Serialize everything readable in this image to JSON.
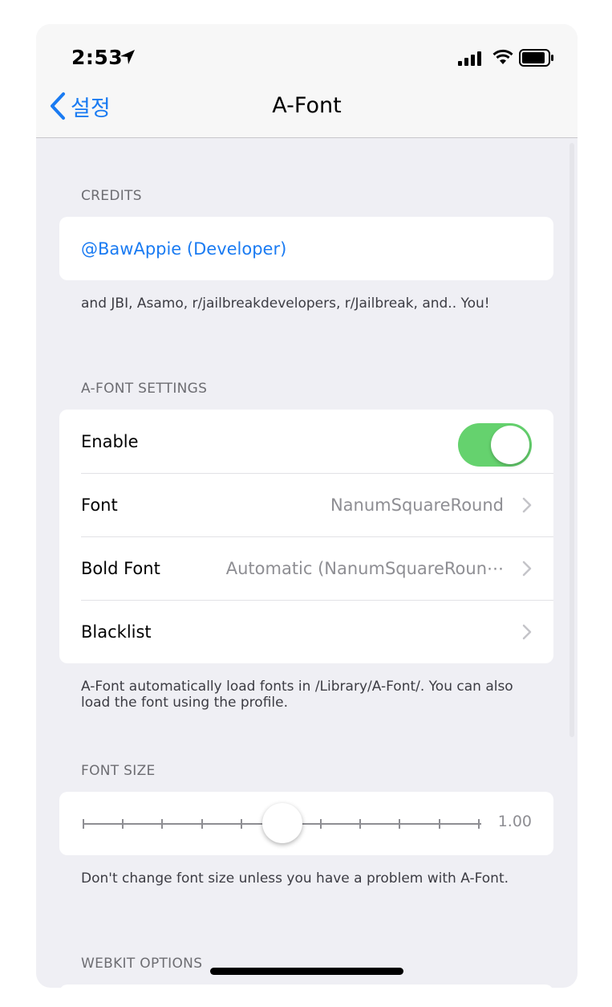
{
  "status_bar": {
    "time": "2:53",
    "icons": [
      "location-arrow-icon",
      "cellular-signal-icon",
      "wifi-icon",
      "battery-icon"
    ]
  },
  "nav": {
    "back_label": "설정",
    "title": "A-Font"
  },
  "colors": {
    "accent": "#1a7bf2",
    "toggle_on": "#65d26e",
    "background": "#efeff4",
    "secondary_text": "#8e8e93"
  },
  "sections": {
    "credits": {
      "header": "CREDITS",
      "link": "@BawAppie (Developer)",
      "footer": "and JBI, Asamo, r/jailbreakdevelopers, r/Jailbreak, and.. You!"
    },
    "settings": {
      "header": "A-FONT SETTINGS",
      "enable_label": "Enable",
      "enable_on": true,
      "font_label": "Font",
      "font_value": "NanumSquareRound",
      "bold_font_label": "Bold Font",
      "bold_font_value": "Automatic (NanumSquareRoun⋯",
      "blacklist_label": "Blacklist",
      "footer": "A-Font automatically load fonts in /Library/A-Font/. You can also load the font using the profile."
    },
    "font_size": {
      "header": "FONT SIZE",
      "value": "1.00",
      "slider_fraction": 0.5,
      "footer": "Don't change font size unless you have a problem with A-Font."
    },
    "webkit": {
      "header": "WEBKIT OPTIONS"
    }
  }
}
